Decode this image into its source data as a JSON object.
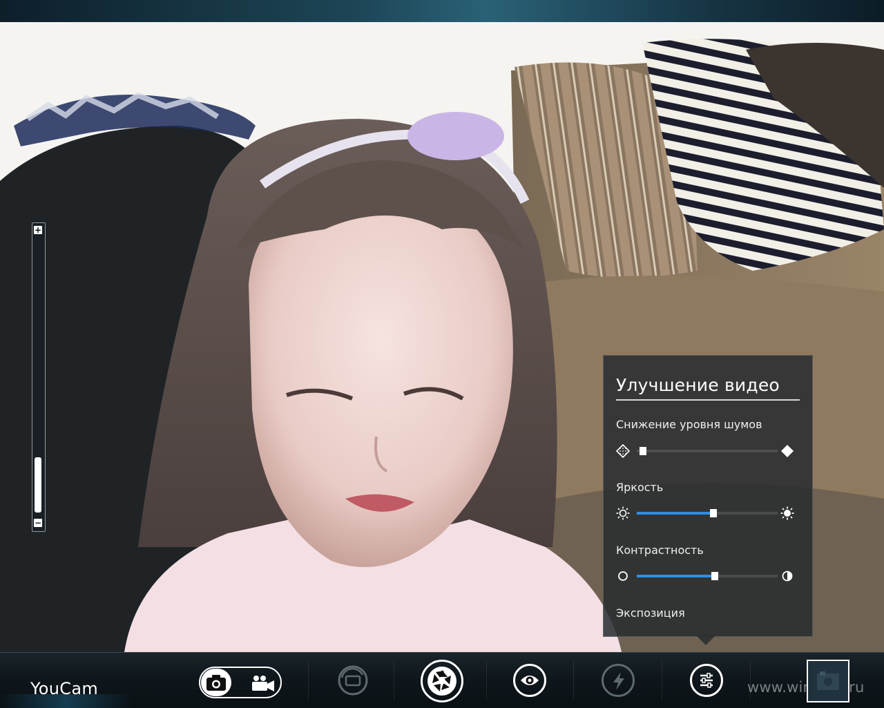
{
  "app": {
    "name": "YouCam"
  },
  "watermark": "www.wincore.ru",
  "panel": {
    "title": "Улучшение видео",
    "noise": {
      "label": "Снижение уровня шумов",
      "value": 0.02
    },
    "brightness": {
      "label": "Яркость",
      "value": 0.52
    },
    "contrast": {
      "label": "Контрастность",
      "value": 0.53
    },
    "exposure": {
      "label": "Экспозиция"
    }
  },
  "zoom": {
    "plus": "+",
    "minus": "−",
    "level": 0.02
  },
  "toolbar": {
    "mode": "photo",
    "icons": [
      "camera-icon",
      "video-camera-icon",
      "rotate-camera-icon",
      "shutter-icon",
      "eye-icon",
      "flash-icon",
      "settings-sliders-icon",
      "gallery-thumbnail-icon"
    ]
  },
  "colors": {
    "accent": "#2f8fe3",
    "panel": "#2a2e32",
    "toolbar": "#0f171c"
  }
}
